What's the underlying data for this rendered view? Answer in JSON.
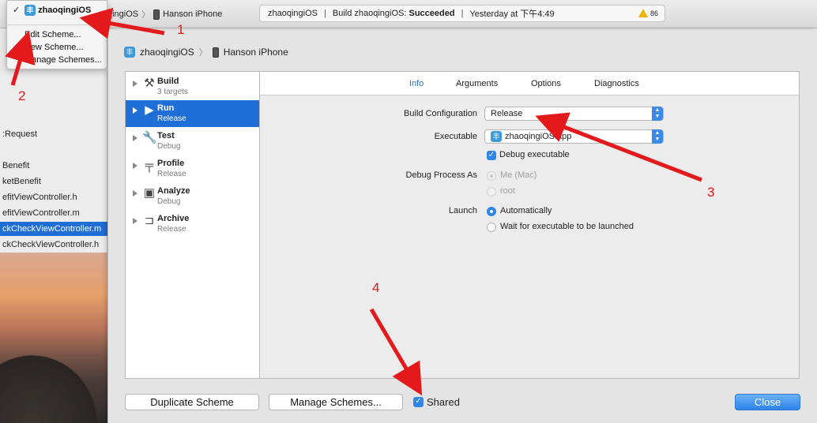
{
  "menu": {
    "current_scheme": "zhaoqingiOS",
    "items": [
      "Edit Scheme...",
      "New Scheme...",
      "Manage Schemes..."
    ]
  },
  "toolbar": {
    "scheme": "qingiOS",
    "device": "Hanson iPhone",
    "activity_project": "zhaoqingiOS",
    "activity_prefix": "Build zhaoqingiOS:",
    "activity_status": "Succeeded",
    "activity_time": "Yesterday at 下午4:49",
    "warning_count": "86"
  },
  "filelist": {
    "items": [
      ":Request",
      "Benefit",
      "ketBenefit",
      "efitViewController.h",
      "efitViewController.m",
      "ckCheckViewController.m",
      "ckCheckViewController.h"
    ],
    "selected_index": 5
  },
  "sheet": {
    "scheme": "zhaoqingiOS",
    "device": "Hanson iPhone",
    "actions": [
      {
        "name": "Build",
        "sub": "3 targets",
        "icon": "hammer-icon"
      },
      {
        "name": "Run",
        "sub": "Release",
        "icon": "play-icon"
      },
      {
        "name": "Test",
        "sub": "Debug",
        "icon": "wrench-icon"
      },
      {
        "name": "Profile",
        "sub": "Release",
        "icon": "caliper-icon"
      },
      {
        "name": "Analyze",
        "sub": "Debug",
        "icon": "analyze-icon"
      },
      {
        "name": "Archive",
        "sub": "Release",
        "icon": "archive-icon"
      }
    ],
    "selected_action": "Run",
    "tabs": [
      "Info",
      "Arguments",
      "Options",
      "Diagnostics"
    ],
    "active_tab": "Info",
    "build_configuration": {
      "label": "Build Configuration",
      "value": "Release"
    },
    "executable": {
      "label": "Executable",
      "value": "zhaoqingiOS.app"
    },
    "debug_executable": {
      "label": "Debug executable",
      "checked": true
    },
    "debug_process_as": {
      "label": "Debug Process As",
      "options": [
        "Me (Mac)",
        "root"
      ],
      "selected": "Me (Mac)",
      "disabled": true
    },
    "launch": {
      "label": "Launch",
      "options": [
        "Automatically",
        "Wait for executable to be launched"
      ],
      "selected": "Automatically"
    },
    "buttons": {
      "duplicate": "Duplicate Scheme",
      "manage": "Manage Schemes...",
      "close": "Close"
    },
    "shared": {
      "label": "Shared",
      "checked": true
    }
  },
  "annotations": [
    "1",
    "2",
    "3",
    "4"
  ],
  "colors": {
    "accent": "#1f6fd6",
    "annotation": "#e3191b",
    "warning": "#f0b400"
  }
}
